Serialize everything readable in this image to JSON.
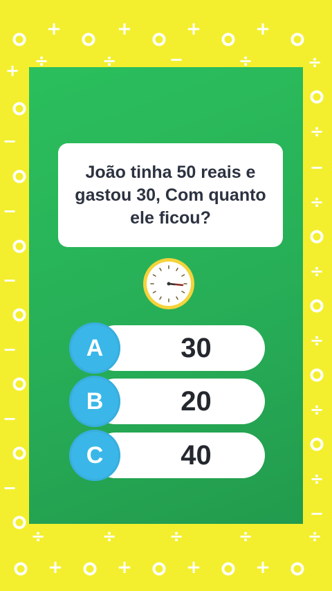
{
  "game": {
    "question": "João tinha 50 reais e gastou 30, Com quanto ele ficou?",
    "timer_icon": "clock-icon",
    "options": [
      {
        "letter": "A",
        "value": "30"
      },
      {
        "letter": "B",
        "value": "20"
      },
      {
        "letter": "C",
        "value": "40"
      }
    ]
  },
  "colors": {
    "background": "#f3ef2e",
    "board": "#27ae57",
    "badge": "#3ab7e8",
    "timer_ring": "#f4d33b"
  },
  "background_symbols": [
    "+",
    "−",
    "÷",
    "o"
  ]
}
